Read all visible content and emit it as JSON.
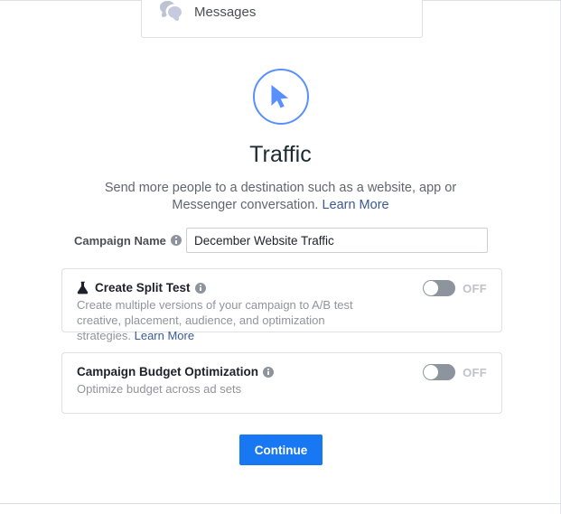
{
  "objective_list": {
    "messages_card": {
      "icon": "messages-bubbles-icon",
      "label": "Messages"
    }
  },
  "objective": {
    "icon": "cursor-pointer-icon",
    "icon_color": "#5890ff",
    "title": "Traffic",
    "description": "Send more people to a destination such as a website, app or Messenger conversation.",
    "learn_more_label": "Learn More"
  },
  "campaign_name": {
    "label": "Campaign Name",
    "info_icon": "info-icon",
    "value": "December Website Traffic",
    "placeholder": "Campaign Name"
  },
  "split_test": {
    "icon": "flask-icon",
    "title": "Create Split Test",
    "info_icon": "info-icon",
    "description": "Create multiple versions of your campaign to A/B test creative, placement, audience, and optimization strategies.",
    "learn_more_label": "Learn More",
    "toggle_state": "OFF"
  },
  "budget_optimization": {
    "title": "Campaign Budget Optimization",
    "info_icon": "info-icon",
    "description": "Optimize budget across ad sets",
    "toggle_state": "OFF"
  },
  "footer": {
    "continue_label": "Continue"
  },
  "colors": {
    "accent_blue": "#1877f2",
    "objective_blue": "#5890ff",
    "link_blue": "#3b5998",
    "toggle_off_track": "#8d949e",
    "muted_text": "#90949c"
  }
}
